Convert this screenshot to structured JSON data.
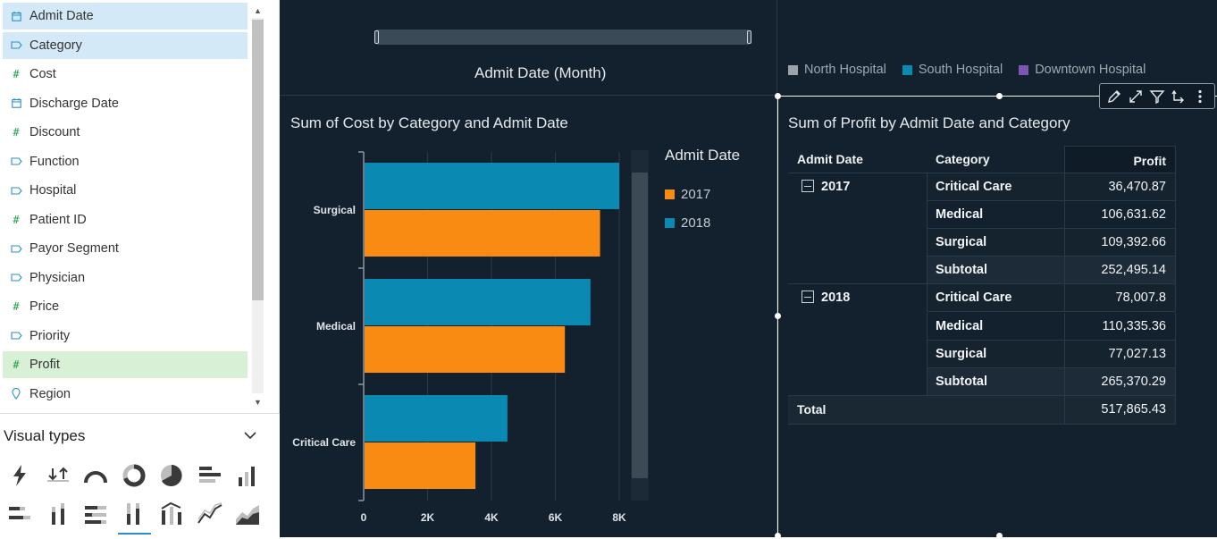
{
  "fields": {
    "items": [
      {
        "label": "Admit Date",
        "type": "date",
        "state": "selected"
      },
      {
        "label": "Category",
        "type": "dimension",
        "state": "selected"
      },
      {
        "label": "Cost",
        "type": "measure",
        "state": ""
      },
      {
        "label": "Discharge Date",
        "type": "date",
        "state": ""
      },
      {
        "label": "Discount",
        "type": "measure",
        "state": ""
      },
      {
        "label": "Function",
        "type": "dimension",
        "state": ""
      },
      {
        "label": "Hospital",
        "type": "dimension",
        "state": ""
      },
      {
        "label": "Patient ID",
        "type": "measure",
        "state": ""
      },
      {
        "label": "Payor Segment",
        "type": "dimension",
        "state": ""
      },
      {
        "label": "Physician",
        "type": "dimension",
        "state": ""
      },
      {
        "label": "Price",
        "type": "measure",
        "state": ""
      },
      {
        "label": "Priority",
        "type": "dimension",
        "state": ""
      },
      {
        "label": "Profit",
        "type": "measure",
        "state": "in-use"
      },
      {
        "label": "Region",
        "type": "geo",
        "state": ""
      }
    ]
  },
  "visual_types": {
    "title": "Visual types",
    "icons": [
      "autograph-icon",
      "kpi-icon",
      "gauge-icon",
      "donut-icon",
      "pie-icon",
      "horizontal-bar-icon",
      "vertical-bar-icon",
      "horizontal-stacked-bar-icon",
      "vertical-stacked-bar-icon",
      "horizontal-stacked-100-bar-icon",
      "vertical-stacked-100-bar-icon",
      "combo-chart-icon",
      "line-chart-icon",
      "area-chart-icon"
    ]
  },
  "filter_control": {
    "label": "Admit Date (Month)"
  },
  "cost_chart": {
    "title": "Sum of Cost by Category and Admit Date",
    "legend_title": "Admit Date",
    "colors": {
      "2017": "#f98b12",
      "2018": "#0a89b2"
    }
  },
  "chart_data": {
    "type": "bar",
    "orientation": "horizontal",
    "title": "Sum of Cost by Category and Admit Date",
    "categories": [
      "Surgical",
      "Medical",
      "Critical Care"
    ],
    "series": [
      {
        "name": "2017",
        "values": [
          7400,
          6300,
          3500
        ]
      },
      {
        "name": "2018",
        "values": [
          8000,
          7100,
          4500
        ]
      }
    ],
    "xlim": [
      0,
      8000
    ],
    "x_ticks": [
      "0",
      "2K",
      "4K",
      "6K",
      "8K"
    ],
    "legend_title": "Admit Date",
    "legend_position": "right",
    "grid": true
  },
  "hospital_legend": [
    {
      "label": "North Hospital",
      "color": "#9aa3aa"
    },
    {
      "label": "South Hospital",
      "color": "#0a89b2"
    },
    {
      "label": "Downtown Hospital",
      "color": "#7c55b3"
    }
  ],
  "pivot": {
    "title": "Sum of Profit by Admit Date and Category",
    "headers": [
      "Admit Date",
      "Category",
      "Profit"
    ],
    "groups": [
      {
        "year": "2017",
        "rows": [
          {
            "category": "Critical Care",
            "profit": "36,470.87"
          },
          {
            "category": "Medical",
            "profit": "106,631.62"
          },
          {
            "category": "Surgical",
            "profit": "109,392.66"
          },
          {
            "category": "Subtotal",
            "profit": "252,495.14"
          }
        ]
      },
      {
        "year": "2018",
        "rows": [
          {
            "category": "Critical Care",
            "profit": "78,007.8"
          },
          {
            "category": "Medical",
            "profit": "110,335.36"
          },
          {
            "category": "Surgical",
            "profit": "77,027.13"
          },
          {
            "category": "Subtotal",
            "profit": "265,370.29"
          }
        ]
      }
    ],
    "total_label": "Total",
    "total_value": "517,865.43"
  },
  "toolbar": {
    "icons": [
      "edit-icon",
      "expand-icon",
      "filter-icon",
      "drill-icon",
      "more-icon"
    ]
  }
}
